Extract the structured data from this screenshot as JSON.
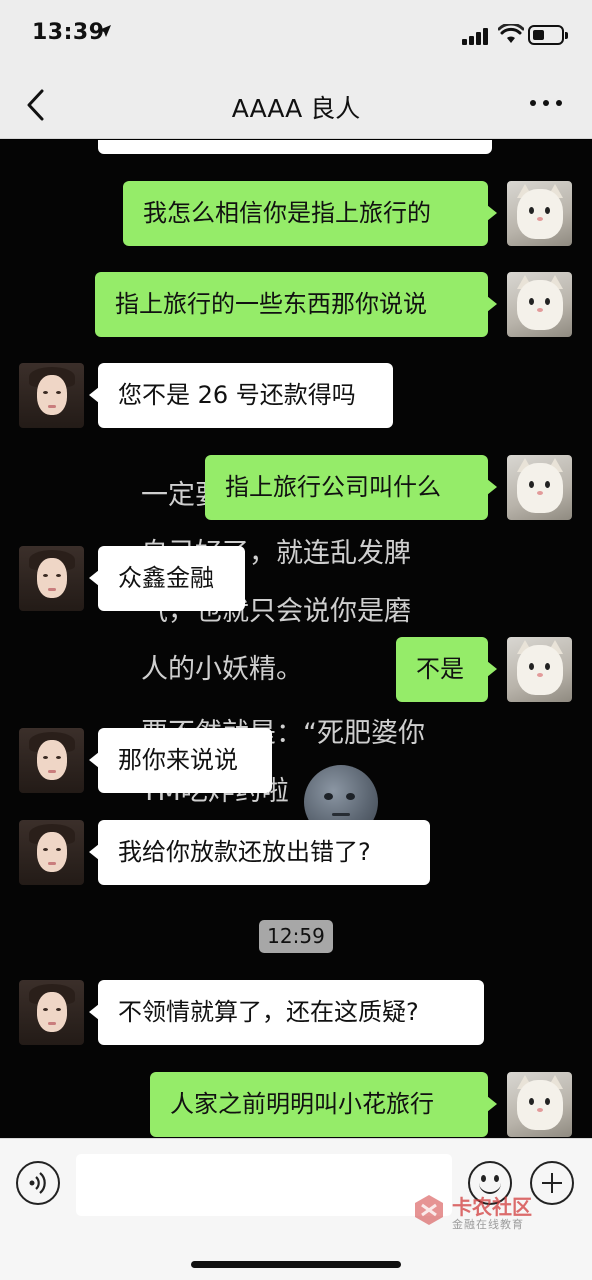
{
  "status_bar": {
    "time": "13:39"
  },
  "nav": {
    "title": "AAAA 良人"
  },
  "background_text": [
    "一定要",
    "自己好了，就连乱发脾",
    "气，也就只会说你是磨",
    "人的小妖精。",
    "要不然就是：“死肥婆你",
    "TM吃炸药啦"
  ],
  "messages": [
    {
      "side": "right",
      "text": "我怎么相信你是指上旅行的"
    },
    {
      "side": "right",
      "text": "指上旅行的一些东西那你说说"
    },
    {
      "side": "left",
      "text": "您不是 26 号还款得吗"
    },
    {
      "side": "right",
      "text": "指上旅行公司叫什么"
    },
    {
      "side": "left",
      "text": "众鑫金融"
    },
    {
      "side": "right",
      "text": "不是"
    },
    {
      "side": "left",
      "text": "那你来说说"
    },
    {
      "side": "left",
      "text": "我给你放款还放出错了?"
    },
    {
      "side": "left",
      "text": "不领情就算了，还在这质疑?"
    },
    {
      "side": "right",
      "text": "人家之前明明叫小花旅行"
    }
  ],
  "time_separator": "12:59",
  "input": {
    "value": "",
    "placeholder": ""
  },
  "watermark": {
    "title": "卡农社区",
    "subtitle": "金融在线教育"
  },
  "colors": {
    "sent_bubble": "#95ec69",
    "received_bubble": "#ffffff",
    "nav_bg": "#ededed",
    "chat_bg": "#050505"
  }
}
